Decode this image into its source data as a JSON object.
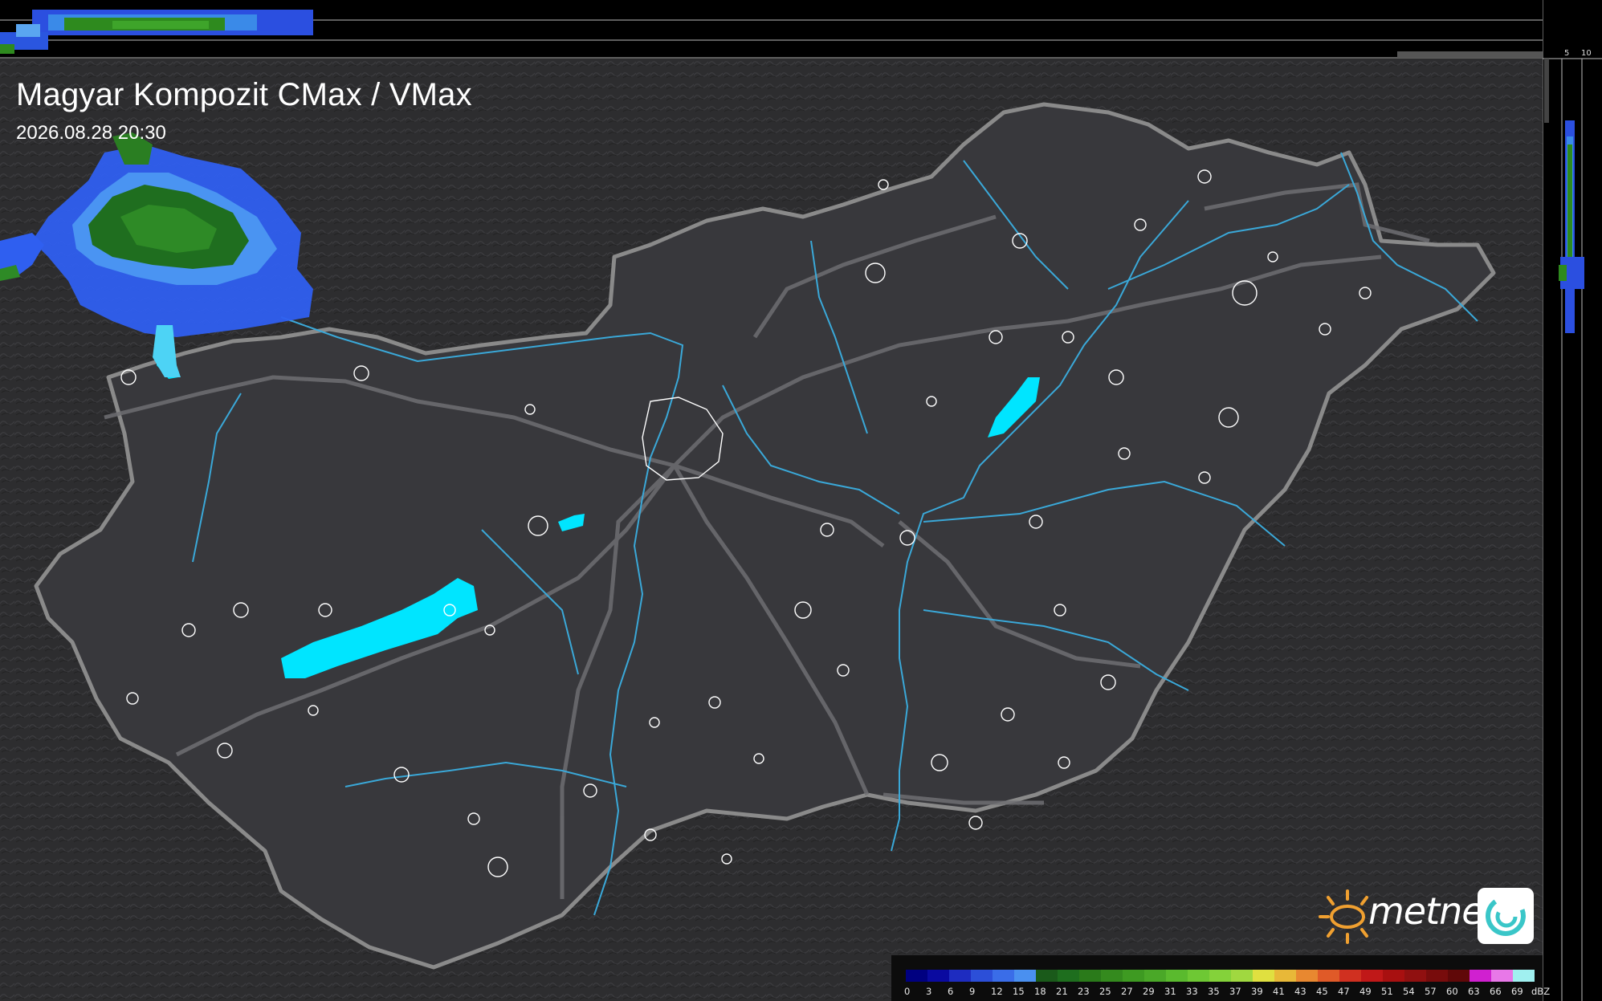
{
  "header": {
    "title": "Magyar Kompozit CMax / VMax",
    "timestamp": "2026.08.28 20:30"
  },
  "top_axis": {
    "labels": [
      "10",
      "5"
    ]
  },
  "right_axis": {
    "labels": [
      "5",
      "10"
    ]
  },
  "legend": {
    "unit": "dBZ",
    "ticks": [
      "0",
      "3",
      "6",
      "9",
      "12",
      "15",
      "18",
      "21",
      "23",
      "25",
      "27",
      "29",
      "31",
      "33",
      "35",
      "37",
      "39",
      "41",
      "43",
      "45",
      "47",
      "49",
      "51",
      "54",
      "57",
      "60",
      "63",
      "66",
      "69"
    ],
    "colors": [
      "#000080",
      "#0a0aa0",
      "#1e2cc0",
      "#2c4fd8",
      "#3a6de8",
      "#4a90f0",
      "#1a5a1a",
      "#1e6e1e",
      "#2a7a1a",
      "#348a1e",
      "#3e9a22",
      "#4aa828",
      "#5aba2e",
      "#6ec834",
      "#84d23a",
      "#a0d840",
      "#e0e040",
      "#e8b838",
      "#e88830",
      "#e05a28",
      "#d03020",
      "#c01818",
      "#a81010",
      "#901010",
      "#780c0c",
      "#600808",
      "#d020d0",
      "#e878e8",
      "#a0f0f0"
    ]
  },
  "branding": {
    "name": "metnet"
  },
  "map": {
    "layers": [
      "terrain-hillshade",
      "country-border",
      "rivers",
      "lakes",
      "cities",
      "roads",
      "radar-reflectivity"
    ],
    "lake_color": "#00e5ff",
    "river_color": "#3aa8d8",
    "border_color": "#8a8a8a"
  }
}
